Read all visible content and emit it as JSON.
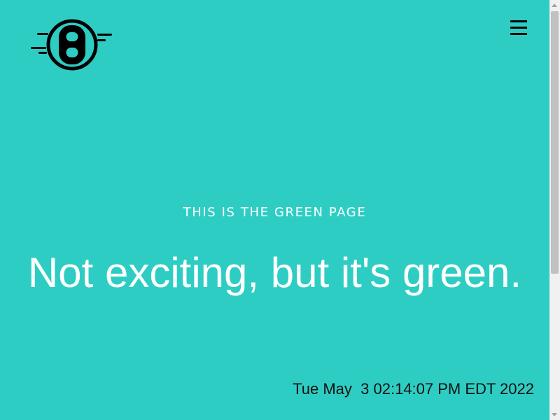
{
  "colors": {
    "background": "#2ecdc4",
    "headline_text": "#ffffff",
    "timestamp_text": "#111111",
    "logo": "#000000"
  },
  "header": {
    "logo_icon": "number-eight-logo",
    "menu_icon": "hamburger-menu-icon"
  },
  "hero": {
    "eyebrow": "THIS IS THE GREEN PAGE",
    "headline": "Not exciting, but it's green."
  },
  "footer": {
    "timestamp": "Tue May  3 02:14:07 PM EDT 2022"
  },
  "scrollbar": {
    "visible_fraction": 0.66
  }
}
